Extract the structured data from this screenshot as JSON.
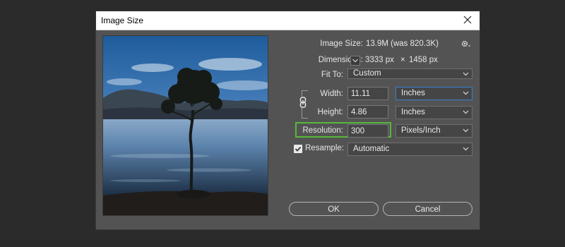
{
  "dialog": {
    "title": "Image Size",
    "image_size": {
      "label": "Image Size:",
      "value": "13.9M (was 820.3K)"
    },
    "dimensions": {
      "label": "Dimensions:",
      "width": "3333 px",
      "sep": "×",
      "height": "1458 px"
    },
    "fit_to": {
      "label": "Fit To:",
      "selected": "Custom"
    },
    "width": {
      "label": "Width:",
      "value": "11.11",
      "unit": "Inches"
    },
    "height": {
      "label": "Height:",
      "value": "4.86",
      "unit": "Inches"
    },
    "resolution": {
      "label": "Resolution:",
      "value": "300",
      "unit": "Pixels/Inch"
    },
    "resample": {
      "label": "Resample:",
      "checked": true,
      "selected": "Automatic"
    },
    "buttons": {
      "ok": "OK",
      "cancel": "Cancel"
    }
  },
  "icons": {
    "close": "close-icon",
    "settings": "gear-icon",
    "link": "chain-link-icon",
    "chevron": "chevron-down-icon",
    "check": "checkmark-icon"
  },
  "colors": {
    "dialog_bg": "#535353",
    "highlight": "#58b83a",
    "focus": "#3b7fd6"
  }
}
